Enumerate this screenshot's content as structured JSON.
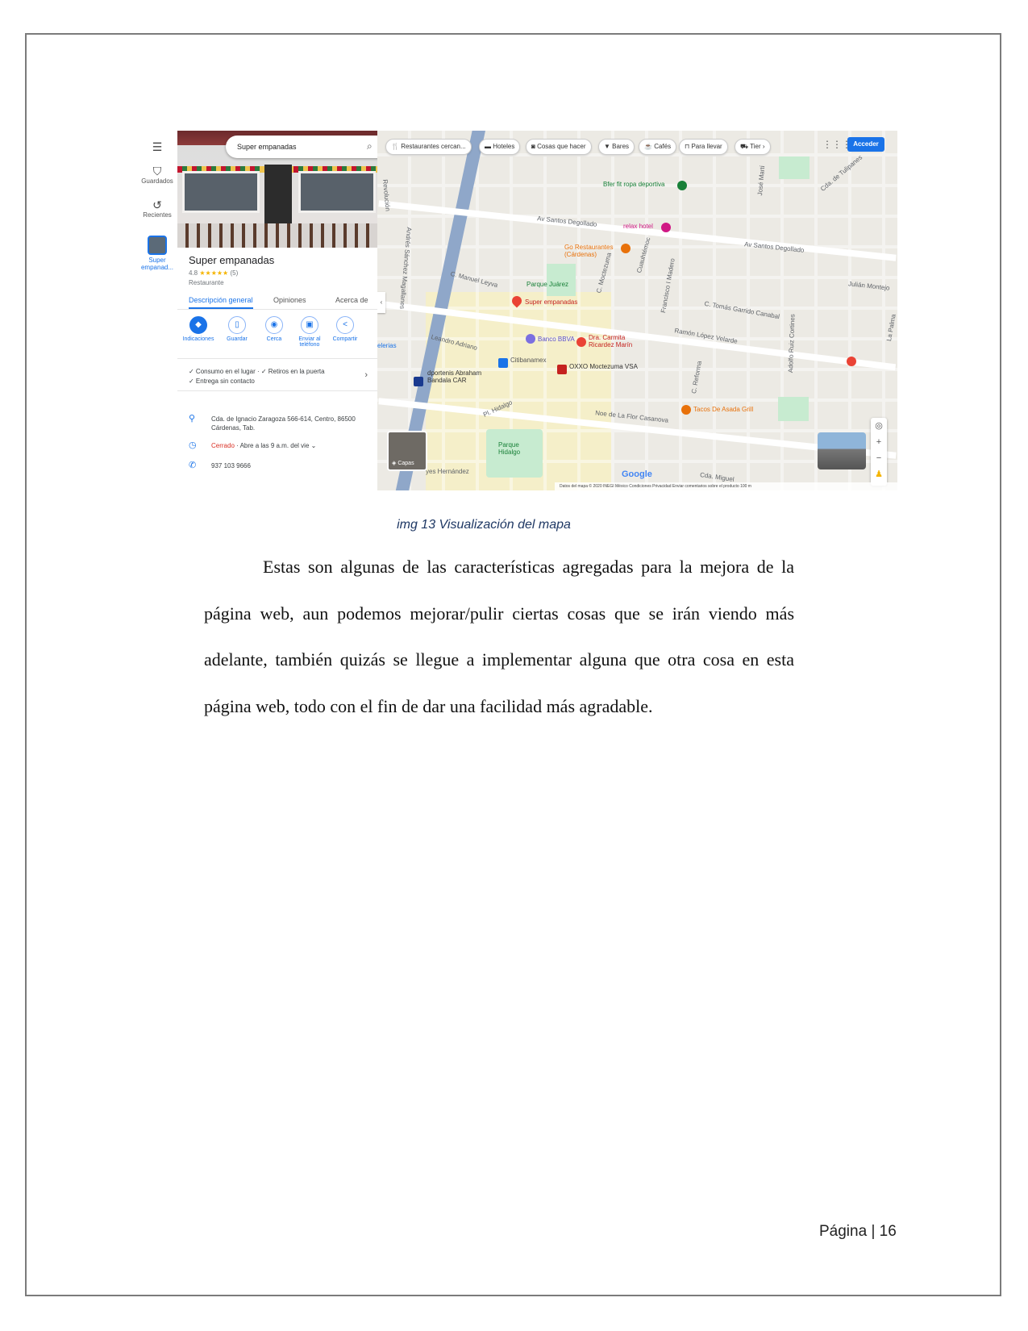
{
  "maps_screenshot": {
    "rail": {
      "menu_icon": "hamburger-icon",
      "saved_label": "Guardados",
      "recent_label": "Recientes",
      "place_thumb_label_1": "Super",
      "place_thumb_label_2": "empanad..."
    },
    "search": {
      "query": "Super empanadas"
    },
    "place": {
      "name": "Super empanadas",
      "rating": "4.8",
      "stars": "★★★★★",
      "reviews": "(5)",
      "category": "Restaurante"
    },
    "tabs": [
      "Descripción general",
      "Opiniones",
      "Acerca de"
    ],
    "actions": [
      {
        "label": "Indicaciones",
        "icon": "directions-icon"
      },
      {
        "label": "Guardar",
        "icon": "bookmark-icon"
      },
      {
        "label": "Cerca",
        "icon": "nearby-icon"
      },
      {
        "label": "Enviar al teléfono",
        "icon": "send-to-phone-icon"
      },
      {
        "label": "Compartir",
        "icon": "share-icon"
      }
    ],
    "features": {
      "line1": "✓ Consumo en el lugar · ✓ Retiros en la puerta",
      "line2": "✓ Entrega sin contacto"
    },
    "address": "Cda. de Ignacio Zaragoza 566-614, Centro, 86500 Cárdenas, Tab.",
    "hours_status": "Cerrado",
    "hours_detail": " · Abre a las 9 a.m. del vie",
    "phone": "937 103 9666",
    "chips": [
      "Restaurantes cercan...",
      "Hoteles",
      "Cosas que hacer",
      "Bares",
      "Cafés",
      "Para llevar",
      "Tier"
    ],
    "acceder": "Acceder",
    "map_labels": {
      "av_santos_1": "Av Santos Degollado",
      "av_santos_2": "Av Santos Degollado",
      "manuel_leyva": "C. Manuel Leyva",
      "parque_juarez": "Parque Juárez",
      "leandro": "Leandro Adriano",
      "ramon": "Ramón López Velarde",
      "tomas": "C. Tomás Garrido Canabal",
      "julian": "Julián Montejo",
      "noe": "Noe de La Flor Casanova",
      "hidalgo": "Pl. Hidalgo",
      "parque_hidalgo": "Parque Hidalgo",
      "reyes": "yes Hernández",
      "revolucion": "Revolución",
      "andres": "Andrés Sánchez Magallanes",
      "moctezuma": "C. Moctezuma",
      "cuauhtemoc": "Cuauhtémoc",
      "madero": "Francisco I Madero",
      "jose_marti": "José Martí",
      "reforma": "C. Reforma",
      "adolfo": "Adolfo Ruiz Cortines",
      "cda_tulipanes": "Cda. de Tulipanes",
      "la_palma": "La Palma",
      "cda_miguel": "Cda. Miguel"
    },
    "pois": {
      "super_empanadas": "Super empanadas",
      "bfer": "Bfer fit ropa deportiva",
      "relax": "relax hotel",
      "go_rest": "Go Restaurantes (Cárdenas)",
      "bbva": "Banco BBVA",
      "dra": "Dra. Carmita Ricardez Marín",
      "citibanamex": "Citibanamex",
      "oxxo": "OXXO Moctezuma VSA",
      "dp": "dportenis Abraham Bandala CAR",
      "tacos": "Tacos De Asada Grill",
      "telerias": "elerias"
    },
    "capas": "Capas",
    "google": "Google",
    "footer": "Datos del mapa © 2020 INEGI   México   Condiciones   Privacidad   Enviar comentarios sobre el producto   100 m"
  },
  "caption": "img 13 Visualización del mapa",
  "paragraph": "Estas son algunas de las características agregadas para la mejora de la página web, aun podemos mejorar/pulir ciertas cosas que se irán viendo más adelante, también quizás se llegue a implementar alguna que otra cosa en esta página web, todo con el fin de dar una facilidad más agradable.",
  "page_number": "Página | 16"
}
